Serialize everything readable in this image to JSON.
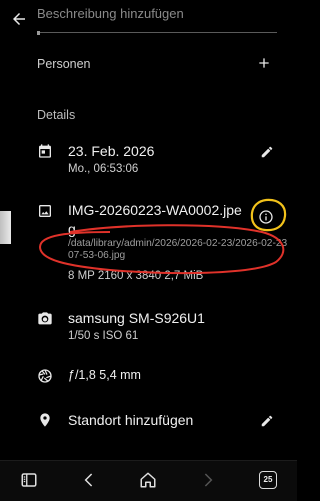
{
  "header": {
    "description_placeholder": "Beschreibung hinzufügen"
  },
  "people": {
    "label": "Personen"
  },
  "details": {
    "label": "Details",
    "date": {
      "primary": "23. Feb. 2026",
      "secondary": "Mo., 06:53:06"
    },
    "file": {
      "name": "IMG-20260223-WA0002.jpe g",
      "path": "/data/library/admin/2026/2026-02-23/2026-02-23 07-53-06.jpg",
      "meta": "8 MP 2160 x 3840 2,7 MiB"
    },
    "camera": {
      "primary": "samsung SM-S926U1",
      "secondary": "1/50 s ISO 61"
    },
    "lens": {
      "primary": "ƒ/1,8 5,4 mm"
    },
    "location": {
      "primary": "Standort hinzufügen"
    }
  },
  "navbar": {
    "tab_count": "25"
  },
  "colors": {
    "background": "#000000",
    "annotation_red": "#e0322a",
    "annotation_yellow": "#f2c21b"
  },
  "icons": [
    "back-arrow-icon",
    "plus-icon",
    "calendar-icon",
    "image-icon",
    "info-icon",
    "camera-icon",
    "aperture-icon",
    "location-pin-icon",
    "edit-pencil-icon",
    "sidebar-icon",
    "chevron-left-icon",
    "home-icon",
    "chevron-right-icon",
    "tabs-icon"
  ]
}
